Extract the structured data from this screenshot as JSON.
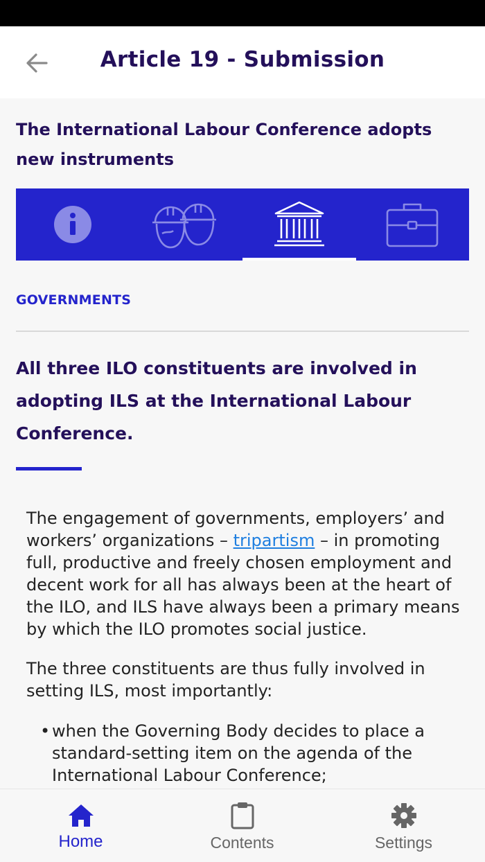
{
  "header": {
    "title": "Article 19 - Submission",
    "back_icon": "arrow-left-icon"
  },
  "subtitle": "The International Labour Conference adopts new instruments",
  "tabs": [
    {
      "icon": "info-icon",
      "active": false
    },
    {
      "icon": "workers-hardhat-icon",
      "active": false
    },
    {
      "icon": "government-building-icon",
      "active": true
    },
    {
      "icon": "briefcase-icon",
      "active": false
    }
  ],
  "section_label": "GOVERNMENTS",
  "headline": "All three ILO constituents are involved in adopting ILS at the International Labour Conference.",
  "paragraph1": {
    "before_link": "The engagement of governments, employers’ and workers’ organizations – ",
    "link": "tripartism",
    "after_link": " – in promoting full, productive and freely chosen employment and decent work for all has always been at the heart of the ILO, and ILS have always been a primary means by which the ILO promotes social justice."
  },
  "paragraph2": "The three constituents are thus fully involved in setting ILS, most importantly:",
  "bullets": [
    "when the Governing Body decides to place a standard-setting item on the agenda of the International Labour Conference;"
  ],
  "bottom_nav": [
    {
      "label": "Home",
      "icon": "home-icon",
      "active": true
    },
    {
      "label": "Contents",
      "icon": "clipboard-icon",
      "active": false
    },
    {
      "label": "Settings",
      "icon": "gear-icon",
      "active": false
    }
  ],
  "colors": {
    "brand_blue": "#2424cc",
    "title_purple": "#24105a",
    "link_blue": "#1f7fe0",
    "tab_icon_inactive": "#8a8ae6",
    "tab_icon_active": "#ffffff"
  }
}
